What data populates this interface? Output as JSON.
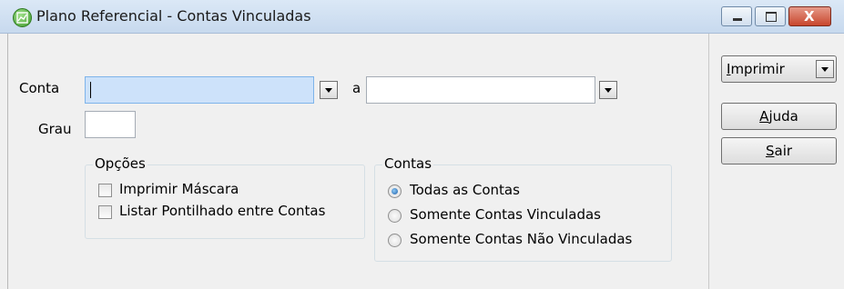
{
  "window": {
    "title": "Plano Referencial - Contas Vinculadas",
    "close_glyph": "X"
  },
  "form": {
    "conta_label": "Conta",
    "conta_from_value": "",
    "range_separator": "a",
    "conta_to_value": "",
    "grau_label": "Grau",
    "grau_value": ""
  },
  "opcoes": {
    "title": "Opções",
    "items": [
      {
        "label": "Imprimir Máscara",
        "checked": false
      },
      {
        "label": "Listar Pontilhado entre Contas",
        "checked": false
      }
    ]
  },
  "contas": {
    "title": "Contas",
    "items": [
      {
        "label": "Todas as Contas",
        "selected": true
      },
      {
        "label": "Somente Contas Vinculadas",
        "selected": false
      },
      {
        "label": "Somente Contas Não Vinculadas",
        "selected": false
      }
    ]
  },
  "actions": {
    "print": {
      "mnemonic": "I",
      "rest": "mprimir"
    },
    "help": {
      "mnemonic": "A",
      "rest": "juda"
    },
    "exit": {
      "mnemonic": "S",
      "rest": "air"
    }
  },
  "icons": {
    "app": "chart-app-icon",
    "minimize": "minimize-icon",
    "maximize": "maximize-icon",
    "close": "close-icon",
    "dropdown": "chevron-down-icon"
  }
}
